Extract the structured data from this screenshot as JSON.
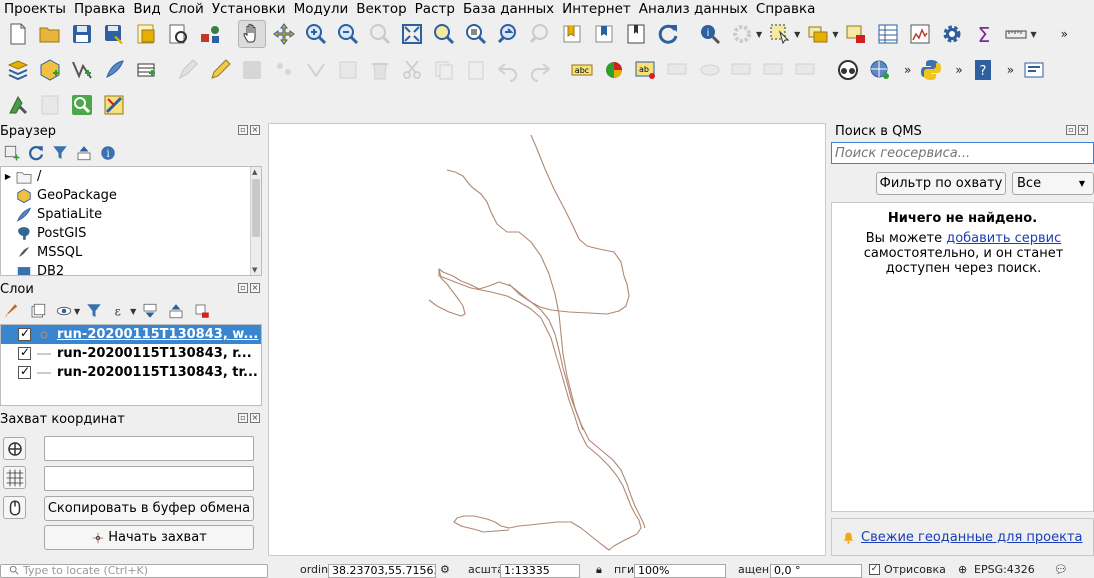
{
  "menu": [
    "Проекты",
    "Правка",
    "Вид",
    "Слой",
    "Установки",
    "Модули",
    "Вектор",
    "Растр",
    "База данных",
    "Интернет",
    "Анализ данных",
    "Справка"
  ],
  "toolbar_more": "»",
  "browser_panel": {
    "title": "Браузер",
    "items": [
      "/",
      "GeoPackage",
      "SpatiaLite",
      "PostGIS",
      "MSSQL",
      "DB2"
    ]
  },
  "layers_panel": {
    "title": "Слои",
    "layers": [
      {
        "name": "run-20200115T130843, w...",
        "checked": true,
        "selected": true
      },
      {
        "name": "run-20200115T130843, r...",
        "checked": true,
        "selected": false
      },
      {
        "name": "run-20200115T130843, tr...",
        "checked": true,
        "selected": false
      }
    ]
  },
  "coord_panel": {
    "title": "Захват координат",
    "field1_value": "",
    "field2_value": "",
    "copy_button": "Скопировать в буфер обмена",
    "start_button": "Начать захват"
  },
  "qms_panel": {
    "title": "Поиск в QMS",
    "search_placeholder": "Поиск геосервиса...",
    "filter_button": "Фильтр по охвату",
    "filter_select": "Все",
    "empty_title": "Ничего не найдено.",
    "empty_text_1": "Вы можете",
    "empty_link": "добавить сервис",
    "empty_text_2": "самостоятельно, и он станет доступен через поиск.",
    "footer_link": "Свежие геоданные для проекта"
  },
  "statusbar": {
    "locate_placeholder": "Type to locate (Ctrl+K)",
    "coord_label": "ordin",
    "coord_value": "38.23703,55.71563",
    "scale_label": "асшта",
    "scale_value": "1:13335",
    "magnifier_label": "пги",
    "magnifier_value": "100%",
    "rotation_label": "ащен",
    "rotation_value": "0,0 °",
    "render_label": "Отрисовка",
    "crs": "EPSG:4326"
  },
  "colors": {
    "selection": "#3a85d0",
    "track_line": "#b08872",
    "link": "#1a3db8"
  }
}
